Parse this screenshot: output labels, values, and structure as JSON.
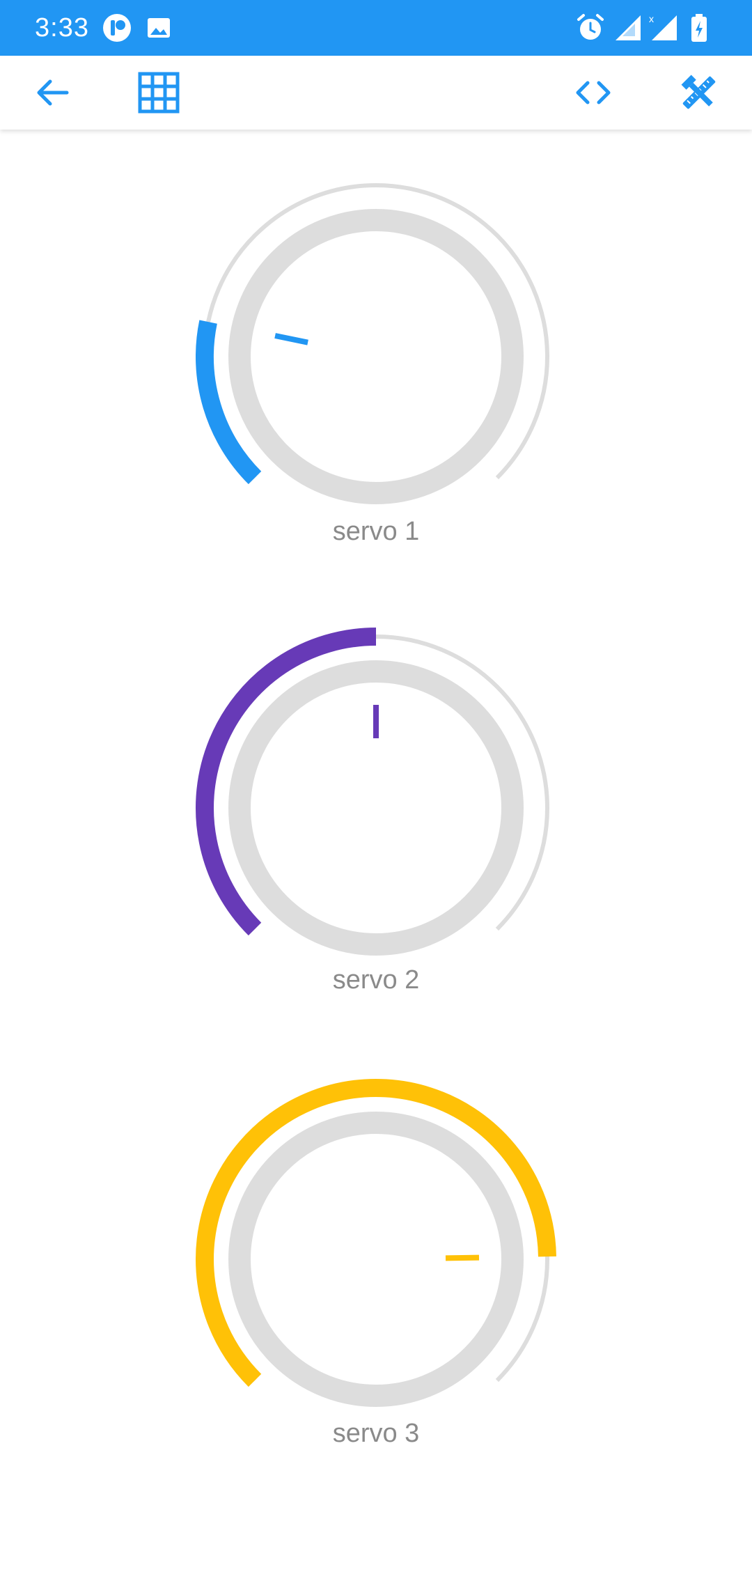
{
  "status_bar": {
    "time": "3:33",
    "icons": [
      "app-notification-icon",
      "image-icon",
      "alarm-icon",
      "signal-icon",
      "signal-no-data-icon",
      "battery-charging-icon"
    ]
  },
  "toolbar": {
    "back_icon": "arrow-left-icon",
    "grid_icon": "grid-icon",
    "code_icon": "code-icon",
    "tools_icon": "tools-icon",
    "accent": "#2196f3"
  },
  "knobs": [
    {
      "label": "servo 1",
      "color": "#2196f3",
      "value_fraction": 0.21
    },
    {
      "label": "servo 2",
      "color": "#673ab7",
      "value_fraction": 0.5
    },
    {
      "label": "servo 3",
      "color": "#ffc107",
      "value_fraction": 0.83
    }
  ],
  "track_color": "#dddddd"
}
